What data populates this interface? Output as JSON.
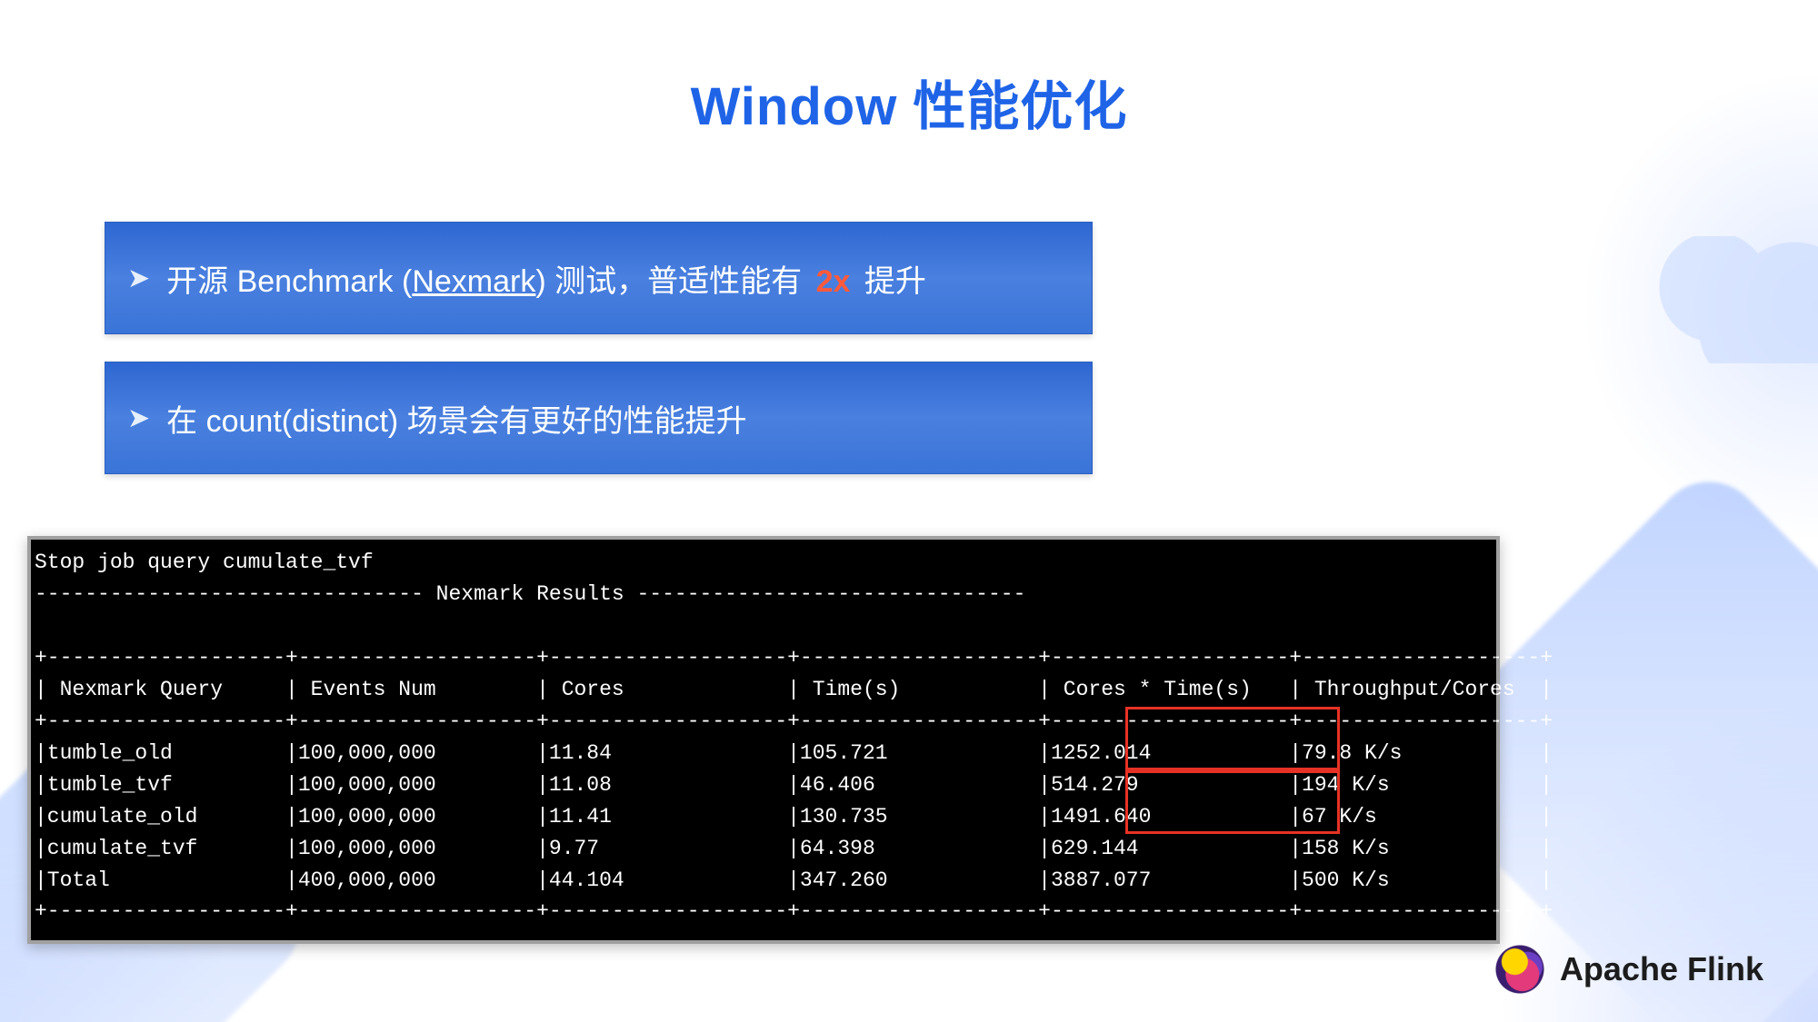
{
  "title": "Window 性能优化",
  "bullets": {
    "b1_pre": "开源 Benchmark (",
    "b1_link": "Nexmark",
    "b1_mid": ") 测试，普适性能有 ",
    "b1_hl": "2x",
    "b1_post": " 提升",
    "b2": "在 count(distinct) 场景会有更好的性能提升"
  },
  "terminal": {
    "line1": "Stop job query cumulate_tvf",
    "line2": "------------------------------- Nexmark Results -------------------------------",
    "blank": "",
    "sep": "+-------------------+-------------------+-------------------+-------------------+-------------------+-------------------+",
    "hdr": "| Nexmark Query     | Events Num        | Cores             | Time(s)           | Cores * Time(s)   | Throughput/Cores  |",
    "r1": "|tumble_old         |100,000,000        |11.84              |105.721            |1252.014           |79.8 K/s           |",
    "r2": "|tumble_tvf         |100,000,000        |11.08              |46.406             |514.279            |194 K/s            |",
    "r3": "|cumulate_old       |100,000,000        |11.41              |130.735            |1491.640           |67 K/s             |",
    "r4": "|cumulate_tvf       |100,000,000        |9.77               |64.398             |629.144            |158 K/s            |",
    "r5": "|Total              |400,000,000        |44.104             |347.260            |3887.077           |500 K/s            |"
  },
  "chart_data": {
    "type": "table",
    "title": "Nexmark Results",
    "columns": [
      "Nexmark Query",
      "Events Num",
      "Cores",
      "Time(s)",
      "Cores * Time(s)",
      "Throughput/Cores"
    ],
    "rows": [
      [
        "tumble_old",
        "100,000,000",
        11.84,
        105.721,
        1252.014,
        "79.8 K/s"
      ],
      [
        "tumble_tvf",
        "100,000,000",
        11.08,
        46.406,
        514.279,
        "194 K/s"
      ],
      [
        "cumulate_old",
        "100,000,000",
        11.41,
        130.735,
        1491.64,
        "67 K/s"
      ],
      [
        "cumulate_tvf",
        "100,000,000",
        9.77,
        64.398,
        629.144,
        "158 K/s"
      ],
      [
        "Total",
        "400,000,000",
        44.104,
        347.26,
        3887.077,
        "500 K/s"
      ]
    ],
    "highlighted_column": "Cores * Time(s)",
    "highlighted_pairs": [
      [
        "tumble_old",
        "tumble_tvf"
      ],
      [
        "cumulate_old",
        "cumulate_tvf"
      ]
    ]
  },
  "logo": "Apache Flink"
}
